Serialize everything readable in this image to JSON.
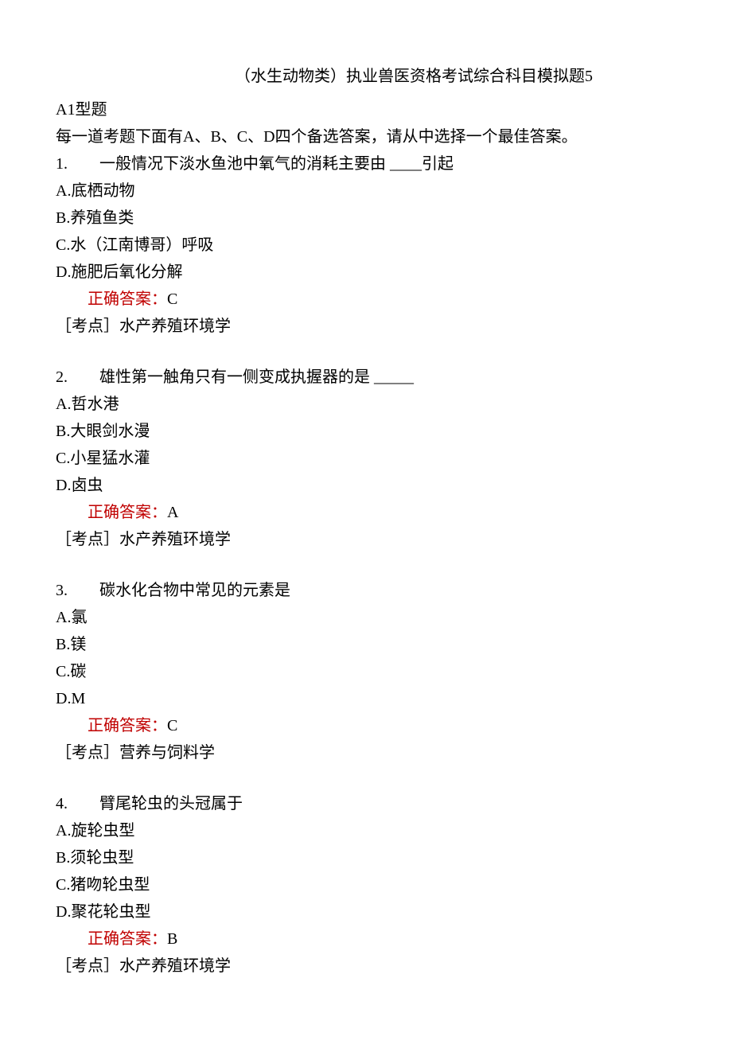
{
  "title": "（水生动物类）执业兽医资格考试综合科目模拟题5",
  "section_type": "A1型题",
  "instruction": "每一道考题下面有A、B、C、D四个备选答案，请从中选择一个最佳答案。",
  "answer_label": "正确答案：",
  "topic_label": "［考点］",
  "questions": [
    {
      "number": "1.",
      "text": "一般情况下淡水鱼池中氧气的消耗主要由 ____引起",
      "options": {
        "A": "A.底栖动物",
        "B": "B.养殖鱼类",
        "C": "C.水（江南博哥）呼吸",
        "D": "D.施肥后氧化分解"
      },
      "answer": "C",
      "topic": "水产养殖环境学"
    },
    {
      "number": "2.",
      "text": "雄性第一触角只有一侧变成执握器的是 _____",
      "options": {
        "A": "A.哲水港",
        "B": "B.大眼剑水漫",
        "C": "C.小星猛水灌",
        "D": "D.卤虫"
      },
      "answer": "A",
      "topic": "水产养殖环境学"
    },
    {
      "number": "3.",
      "text": "碳水化合物中常见的元素是",
      "options": {
        "A": "A.氯",
        "B": "B.镁",
        "C": "C.碳",
        "D": "D.M"
      },
      "answer": "C",
      "topic": "营养与饲料学"
    },
    {
      "number": "4.",
      "text": "臂尾轮虫的头冠属于",
      "options": {
        "A": "A.旋轮虫型",
        "B": "B.须轮虫型",
        "C": "C.猪吻轮虫型",
        "D": "D.聚花轮虫型"
      },
      "answer": "B",
      "topic": "水产养殖环境学"
    }
  ]
}
